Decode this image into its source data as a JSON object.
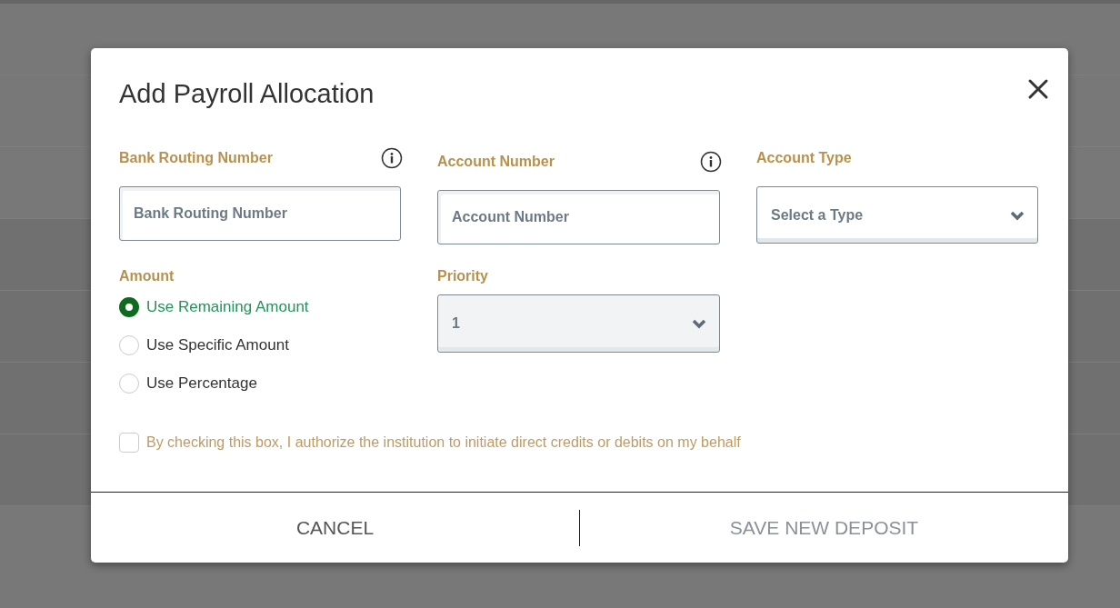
{
  "dialog": {
    "title": "Add Payroll Allocation"
  },
  "fields": [
    {
      "label": "Bank Routing Number",
      "placeholder": "Bank Routing Number",
      "kind": "text",
      "info": true
    },
    {
      "label": "Account Number",
      "placeholder": "Account Number",
      "kind": "text",
      "info": true
    },
    {
      "label": "Account Type",
      "placeholder": "Select a Type",
      "kind": "select",
      "info": false
    }
  ],
  "amount": {
    "label": "Amount",
    "options": [
      {
        "label": "Use Remaining Amount",
        "selected": true
      },
      {
        "label": "Use Specific Amount",
        "selected": false
      },
      {
        "label": "Use Percentage",
        "selected": false
      }
    ]
  },
  "priority": {
    "label": "Priority",
    "value": "1"
  },
  "authorization": {
    "label": "By checking this box, I authorize the institution to initiate direct credits or debits on my behalf",
    "checked": false
  },
  "buttons": [
    {
      "label": "CANCEL",
      "disabled": false
    },
    {
      "label": "SAVE NEW DEPOSIT",
      "disabled": true
    }
  ]
}
